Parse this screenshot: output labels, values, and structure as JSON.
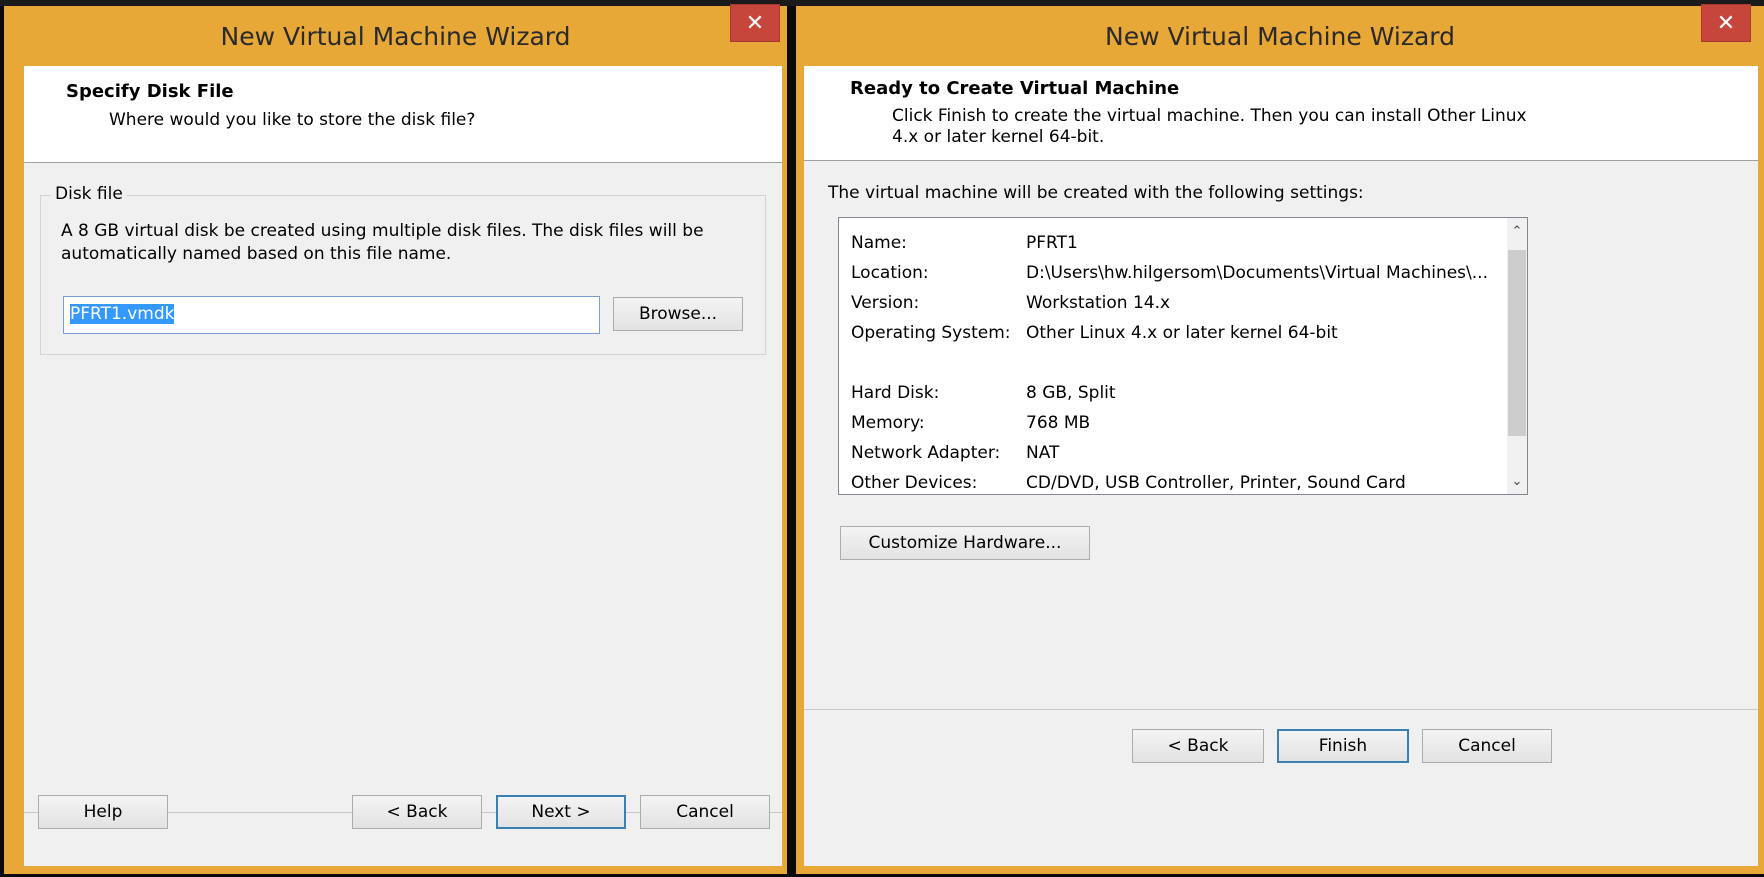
{
  "dialog1": {
    "title": "New Virtual Machine Wizard",
    "close_glyph": "✕",
    "header_title": "Specify Disk File",
    "header_subtitle": "Where would you like to store the disk file?",
    "group_label": "Disk file",
    "description": "A 8 GB virtual disk be created using multiple disk files. The disk files will be automatically named based on this file name.",
    "file_name_value": "PFRT1.vmdk",
    "browse_label": "Browse...",
    "help_label": "Help",
    "back_label": "< Back",
    "next_label": "Next >",
    "cancel_label": "Cancel"
  },
  "dialog2": {
    "title": "New Virtual Machine Wizard",
    "close_glyph": "✕",
    "header_title": "Ready to Create Virtual Machine",
    "header_subtitle": "Click Finish to create the virtual machine. Then you can install Other Linux 4.x or later kernel 64-bit.",
    "intro": "The virtual machine will be created with the following settings:",
    "settings": [
      {
        "key": "Name:",
        "value": "PFRT1"
      },
      {
        "key": "Location:",
        "value": "D:\\Users\\hw.hilgersom\\Documents\\Virtual Machines\\..."
      },
      {
        "key": "Version:",
        "value": "Workstation 14.x"
      },
      {
        "key": "Operating System:",
        "value": "Other Linux 4.x or later kernel 64-bit"
      },
      {
        "key": "",
        "value": ""
      },
      {
        "key": "Hard Disk:",
        "value": "8 GB, Split"
      },
      {
        "key": "Memory:",
        "value": "768 MB"
      },
      {
        "key": "Network Adapter:",
        "value": "NAT"
      },
      {
        "key": "Other Devices:",
        "value": "CD/DVD, USB Controller, Printer, Sound Card"
      }
    ],
    "customize_label": "Customize Hardware...",
    "back_label": "< Back",
    "finish_label": "Finish",
    "cancel_label": "Cancel",
    "scroll_up_glyph": "⌃",
    "scroll_down_glyph": "⌄"
  },
  "colors": {
    "frame": "#e8a838",
    "close": "#c7463c",
    "selection": "#3399ff",
    "client": "#f0f0f0"
  }
}
